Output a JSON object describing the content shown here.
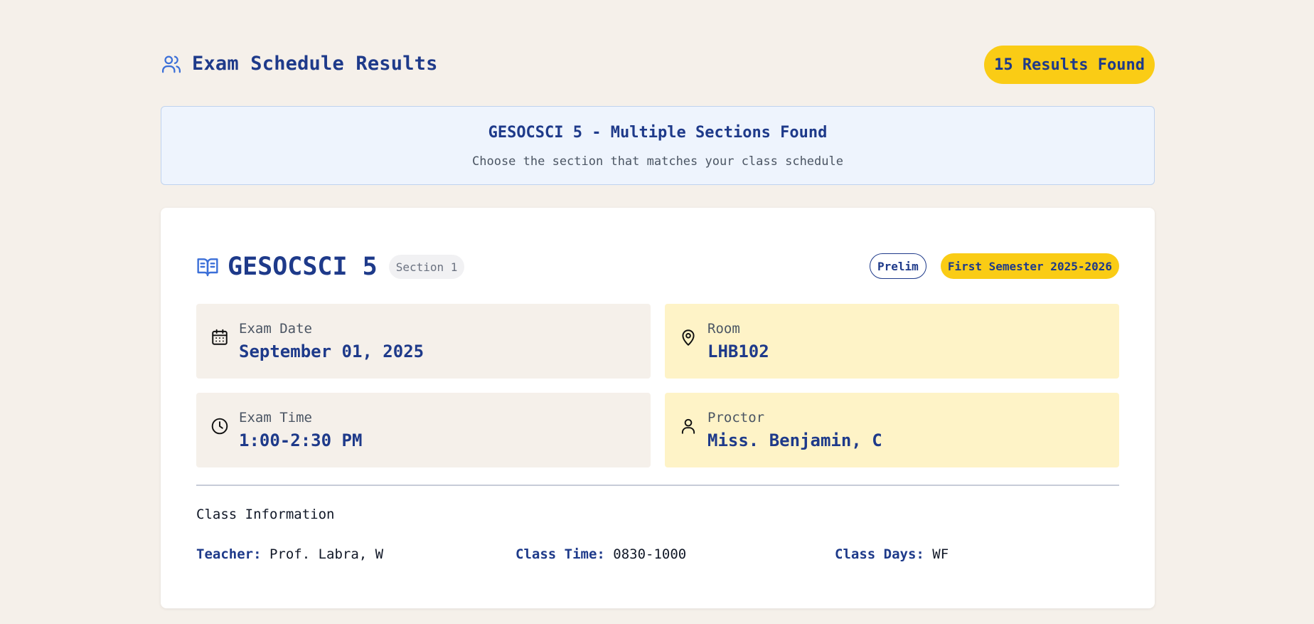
{
  "header": {
    "title": "Exam Schedule Results",
    "results_badge": "15 Results Found"
  },
  "notice": {
    "title": "GESOCSCI 5 - Multiple Sections Found",
    "subtitle": "Choose the section that matches your class schedule"
  },
  "card": {
    "course_code": "GESOCSCI 5",
    "section": "Section 1",
    "exam_type": "Prelim",
    "semester": "First Semester 2025-2026",
    "exam_date": {
      "label": "Exam Date",
      "value": "September 01, 2025"
    },
    "room": {
      "label": "Room",
      "value": "LHB102"
    },
    "exam_time": {
      "label": "Exam Time",
      "value": "1:00-2:30 PM"
    },
    "proctor": {
      "label": "Proctor",
      "value": "Miss. Benjamin, C"
    },
    "class_info": {
      "title": "Class Information",
      "teacher_label": "Teacher:",
      "teacher": "Prof. Labra, W",
      "time_label": "Class Time:",
      "time": "0830-1000",
      "days_label": "Class Days:",
      "days": "WF"
    }
  },
  "colors": {
    "background": "#f5f0ea",
    "primary_text": "#1e3a8a",
    "accent_yellow": "#facc15",
    "notice_bg": "#eef4fd",
    "room_bg": "#fef3c7"
  },
  "icons": {
    "header": "users-icon",
    "course": "book-open-icon",
    "exam_date": "calendar-icon",
    "room": "map-pin-icon",
    "exam_time": "clock-icon",
    "proctor": "user-icon"
  }
}
